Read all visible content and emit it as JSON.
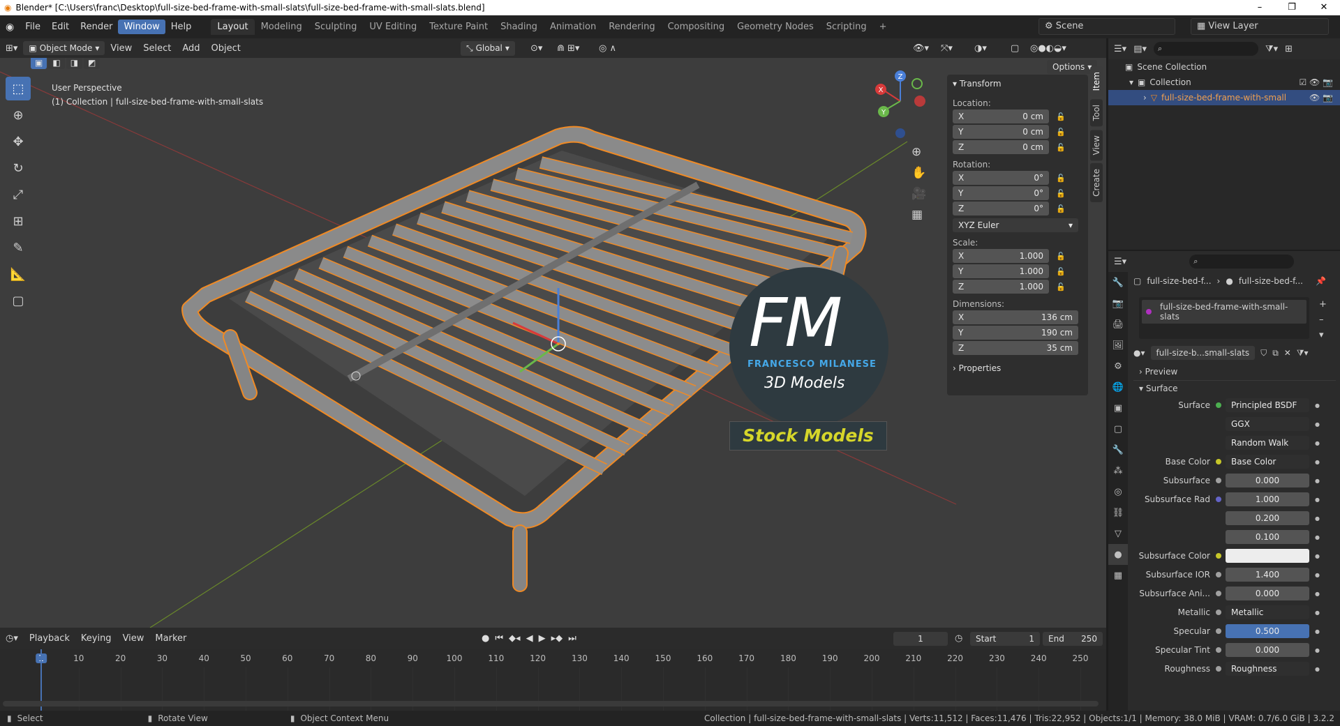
{
  "window": {
    "title": "Blender* [C:\\Users\\franc\\Desktop\\full-size-bed-frame-with-small-slats\\full-size-bed-frame-with-small-slats.blend]"
  },
  "menu": [
    "File",
    "Edit",
    "Render",
    "Window",
    "Help"
  ],
  "workspaces": [
    "Layout",
    "Modeling",
    "Sculpting",
    "UV Editing",
    "Texture Paint",
    "Shading",
    "Animation",
    "Rendering",
    "Compositing",
    "Geometry Nodes",
    "Scripting"
  ],
  "scene": "Scene",
  "view_layer": "View Layer",
  "viewport": {
    "mode": "Object Mode",
    "menus": [
      "View",
      "Select",
      "Add",
      "Object"
    ],
    "transform_orientation": "Global",
    "options_label": "Options",
    "perspective": "User Perspective",
    "collection_info": "(1) Collection | full-size-bed-frame-with-small-slats"
  },
  "watermark": {
    "initials": "FM",
    "name": "FRANCESCO MILANESE",
    "subtitle": "3D Models",
    "banner": "Stock Models"
  },
  "npanel": {
    "header": "Transform",
    "location_label": "Location:",
    "location": [
      {
        "axis": "X",
        "value": "0 cm"
      },
      {
        "axis": "Y",
        "value": "0 cm"
      },
      {
        "axis": "Z",
        "value": "0 cm"
      }
    ],
    "rotation_label": "Rotation:",
    "rotation": [
      {
        "axis": "X",
        "value": "0°"
      },
      {
        "axis": "Y",
        "value": "0°"
      },
      {
        "axis": "Z",
        "value": "0°"
      }
    ],
    "rotation_mode": "XYZ Euler",
    "scale_label": "Scale:",
    "scale": [
      {
        "axis": "X",
        "value": "1.000"
      },
      {
        "axis": "Y",
        "value": "1.000"
      },
      {
        "axis": "Z",
        "value": "1.000"
      }
    ],
    "dimensions_label": "Dimensions:",
    "dimensions": [
      {
        "axis": "X",
        "value": "136 cm"
      },
      {
        "axis": "Y",
        "value": "190 cm"
      },
      {
        "axis": "Z",
        "value": "35 cm"
      }
    ],
    "properties": "Properties",
    "tabs": [
      "Item",
      "Tool",
      "View",
      "Create"
    ]
  },
  "outliner": {
    "scene_collection": "Scene Collection",
    "collection": "Collection",
    "object": "full-size-bed-frame-with-small"
  },
  "properties": {
    "breadcrumb_1": "full-size-bed-f...",
    "breadcrumb_2": "full-size-bed-f...",
    "material_slot": "full-size-bed-frame-with-small-slats",
    "material_name": "full-size-b...small-slats",
    "preview": "Preview",
    "surface_section": "Surface",
    "rows": [
      {
        "label": "Surface",
        "value": "Principled BSDF",
        "dot": "#4caf50",
        "style": "dark"
      },
      {
        "label": "",
        "value": "GGX",
        "style": "dark"
      },
      {
        "label": "",
        "value": "Random Walk",
        "style": "dark"
      },
      {
        "label": "Base Color",
        "value": "Base Color",
        "dot": "#c7c729",
        "style": "dark"
      },
      {
        "label": "Subsurface",
        "value": "0.000",
        "dot": "#a0a0a0",
        "style": ""
      },
      {
        "label": "Subsurface Rad",
        "value": "1.000",
        "dot": "#6464c8",
        "style": ""
      },
      {
        "label": "",
        "value": "0.200",
        "style": ""
      },
      {
        "label": "",
        "value": "0.100",
        "style": ""
      },
      {
        "label": "Subsurface Color",
        "value": "",
        "dot": "#c7c729",
        "style": "white"
      },
      {
        "label": "Subsurface IOR",
        "value": "1.400",
        "dot": "#a0a0a0",
        "style": ""
      },
      {
        "label": "Subsurface Ani...",
        "value": "0.000",
        "dot": "#a0a0a0",
        "style": ""
      },
      {
        "label": "Metallic",
        "value": "Metallic",
        "dot": "#a0a0a0",
        "style": "dark"
      },
      {
        "label": "Specular",
        "value": "0.500",
        "dot": "#a0a0a0",
        "style": "blue"
      },
      {
        "label": "Specular Tint",
        "value": "0.000",
        "dot": "#a0a0a0",
        "style": ""
      },
      {
        "label": "Roughness",
        "value": "Roughness",
        "dot": "#a0a0a0",
        "style": "dark"
      }
    ]
  },
  "timeline": {
    "menus": [
      "Playback",
      "Keying",
      "View",
      "Marker"
    ],
    "current_frame": "1",
    "start_label": "Start",
    "start": "1",
    "end_label": "End",
    "end": "250",
    "ticks": [
      "1",
      "10",
      "20",
      "30",
      "40",
      "50",
      "60",
      "70",
      "80",
      "90",
      "100",
      "110",
      "120",
      "130",
      "140",
      "150",
      "160",
      "170",
      "180",
      "190",
      "200",
      "210",
      "220",
      "230",
      "240",
      "250"
    ]
  },
  "statusbar": {
    "select": "Select",
    "rotate": "Rotate View",
    "context": "Object Context Menu",
    "info": "Collection | full-size-bed-frame-with-small-slats | Verts:11,512 | Faces:11,476 | Tris:22,952 | Objects:1/1 | Memory: 38.0 MiB | VRAM: 0.7/6.0 GiB | 3.2.2"
  },
  "colors": {
    "accent": "#4772b3",
    "selection": "#f08a24",
    "bg": "#3d3d3d"
  }
}
